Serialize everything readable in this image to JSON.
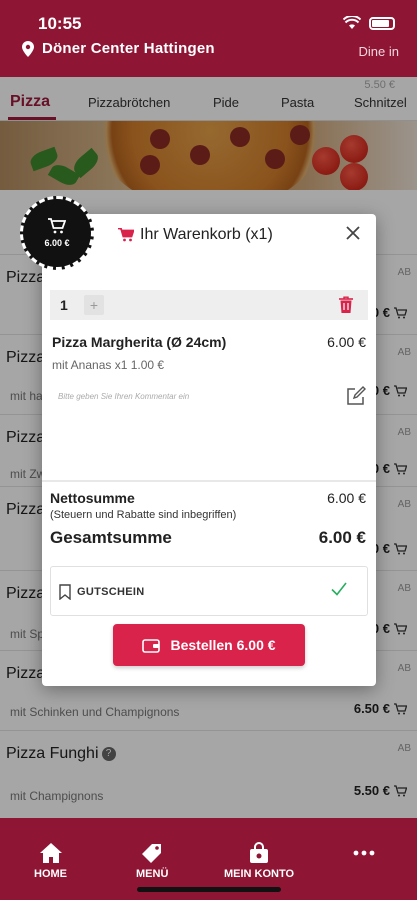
{
  "status": {
    "time": "10:55"
  },
  "header": {
    "restaurant": "Döner Center Hattingen",
    "mode": "Dine in"
  },
  "tabs": [
    {
      "label": "Pizza",
      "active": true
    },
    {
      "label": "Pizzabrötchen"
    },
    {
      "label": "Pide"
    },
    {
      "label": "Pasta"
    },
    {
      "label": "Schnitzel"
    }
  ],
  "tab_price_hint": "5.50 €",
  "products": [
    {
      "title": "Pizza",
      "sub": "",
      "ab": "AB",
      "price": "0 €"
    },
    {
      "title": "Pizza",
      "sub": "mit ha",
      "ab": "AB",
      "price": "0 €"
    },
    {
      "title": "Pizza",
      "sub": "mit Zw",
      "ab": "AB",
      "price": "0 €"
    },
    {
      "title": "Pizza",
      "sub": "",
      "ab": "AB",
      "price": "0 €"
    },
    {
      "title": "Pizza",
      "sub": "mit Sp",
      "ab": "AB",
      "price": "0 €"
    },
    {
      "title": "Pizza",
      "sub": "mit Schinken und Champignons",
      "ab": "AB",
      "price": "6.50 €"
    },
    {
      "title": "Pizza Funghi",
      "sub": "mit Champignons",
      "ab": "AB",
      "price": "5.50 €"
    }
  ],
  "info_badge": "?",
  "cart_badge": {
    "price": "6.00 €"
  },
  "cart": {
    "title": "Ihr Warenkorb (x1)",
    "quantity": "1",
    "plus": "+",
    "item_name": "Pizza Margherita (Ø 24cm)",
    "item_price": "6.00 €",
    "item_extra": "mit Ananas x1 1.00 €",
    "comment_placeholder": "Bitte geben Sie Ihren Kommentar ein",
    "net_label": "Nettosumme",
    "net_value": "6.00 €",
    "tax_note": "(Steuern und Rabatte sind inbegriffen)",
    "total_label": "Gesamtsumme",
    "total_value": "6.00 €",
    "coupon_label": "GUTSCHEIN",
    "order_button": "Bestellen 6.00 €"
  },
  "bottom_nav": [
    {
      "label": "HOME",
      "icon": "home-icon"
    },
    {
      "label": "MENÜ",
      "icon": "tag-icon"
    },
    {
      "label": "MEIN KONTO",
      "icon": "bag-icon"
    },
    {
      "label": "",
      "icon": "more-icon"
    }
  ],
  "colors": {
    "brand": "#8f1535",
    "accent": "#d9234b",
    "check": "#27ae60"
  }
}
